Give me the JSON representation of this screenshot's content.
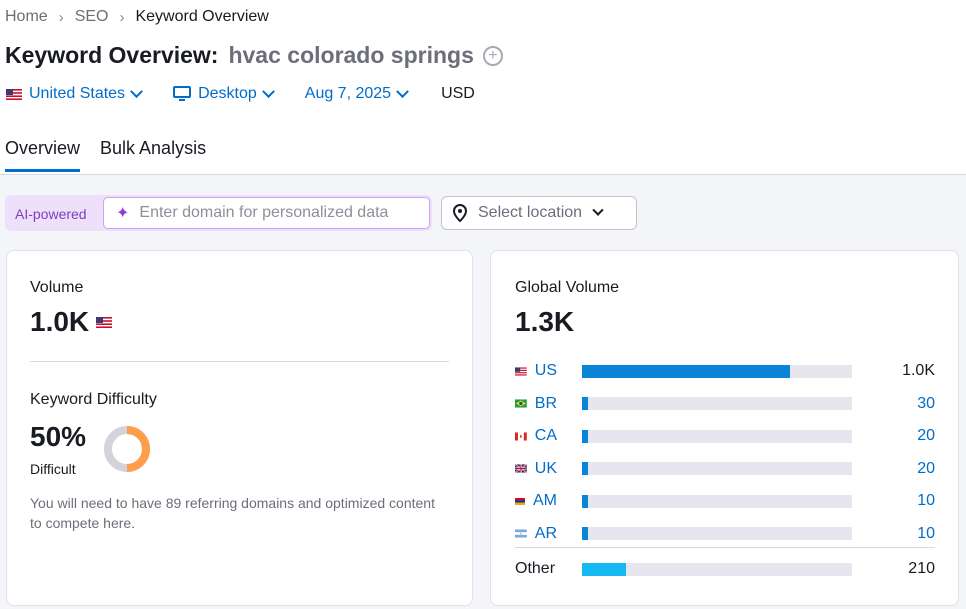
{
  "breadcrumb": [
    "Home",
    "SEO",
    "Keyword Overview"
  ],
  "title": {
    "label": "Keyword Overview:",
    "keyword": "hvac colorado springs"
  },
  "filters": {
    "country": "United States",
    "device": "Desktop",
    "date": "Aug 7, 2025",
    "currency": "USD"
  },
  "tabs": [
    "Overview",
    "Bulk Analysis"
  ],
  "active_tab": "Overview",
  "ai": {
    "badge": "AI-powered",
    "placeholder": "Enter domain for personalized data"
  },
  "location": {
    "placeholder": "Select location"
  },
  "volume": {
    "label": "Volume",
    "value": "1.0K",
    "flag": "us-flag-icon"
  },
  "keyword_difficulty": {
    "label": "Keyword Difficulty",
    "value": "50%",
    "percent": 50,
    "level": "Difficult",
    "description": "You will need to have 89 referring domains and optimized content to compete here.",
    "color": "#ff9d4d"
  },
  "global_volume": {
    "label": "Global Volume",
    "value": "1.3K",
    "countries": [
      {
        "code": "US",
        "value": "1.0K",
        "amount": 1000,
        "flag": "us-flag-icon"
      },
      {
        "code": "BR",
        "value": "30",
        "amount": 30,
        "flag": "br-flag-icon"
      },
      {
        "code": "CA",
        "value": "20",
        "amount": 20,
        "flag": "ca-flag-icon"
      },
      {
        "code": "UK",
        "value": "20",
        "amount": 20,
        "flag": "uk-flag-icon"
      },
      {
        "code": "AM",
        "value": "10",
        "amount": 10,
        "flag": "am-flag-icon"
      },
      {
        "code": "AR",
        "value": "10",
        "amount": 10,
        "flag": "ar-flag-icon"
      }
    ],
    "other": {
      "label": "Other",
      "value": "210",
      "amount": 210
    },
    "max_amount": 1300
  },
  "colors": {
    "accent": "#006dca",
    "bar": "#0a84d6",
    "bar_other": "#14b9f2",
    "ai_bg": "#eee0fb"
  }
}
